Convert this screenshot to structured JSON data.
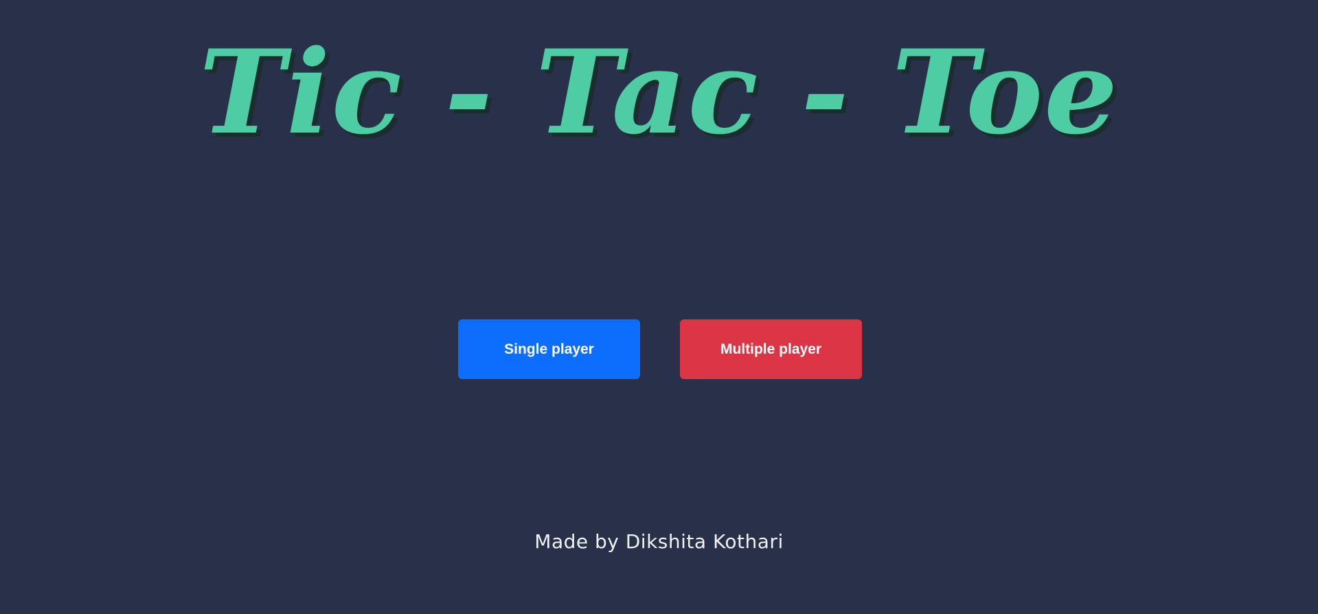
{
  "header": {
    "title": "Tic - Tac - Toe"
  },
  "mode_select": {
    "single_label": "Single player",
    "multi_label": "Multiple player"
  },
  "footer": {
    "credit": "Made by Dikshita Kothari"
  },
  "colors": {
    "background": "#28304a",
    "title": "#4ecda4",
    "single_button": "#0d6efd",
    "multi_button": "#dc3545",
    "footer_text": "#f2f2f2"
  }
}
